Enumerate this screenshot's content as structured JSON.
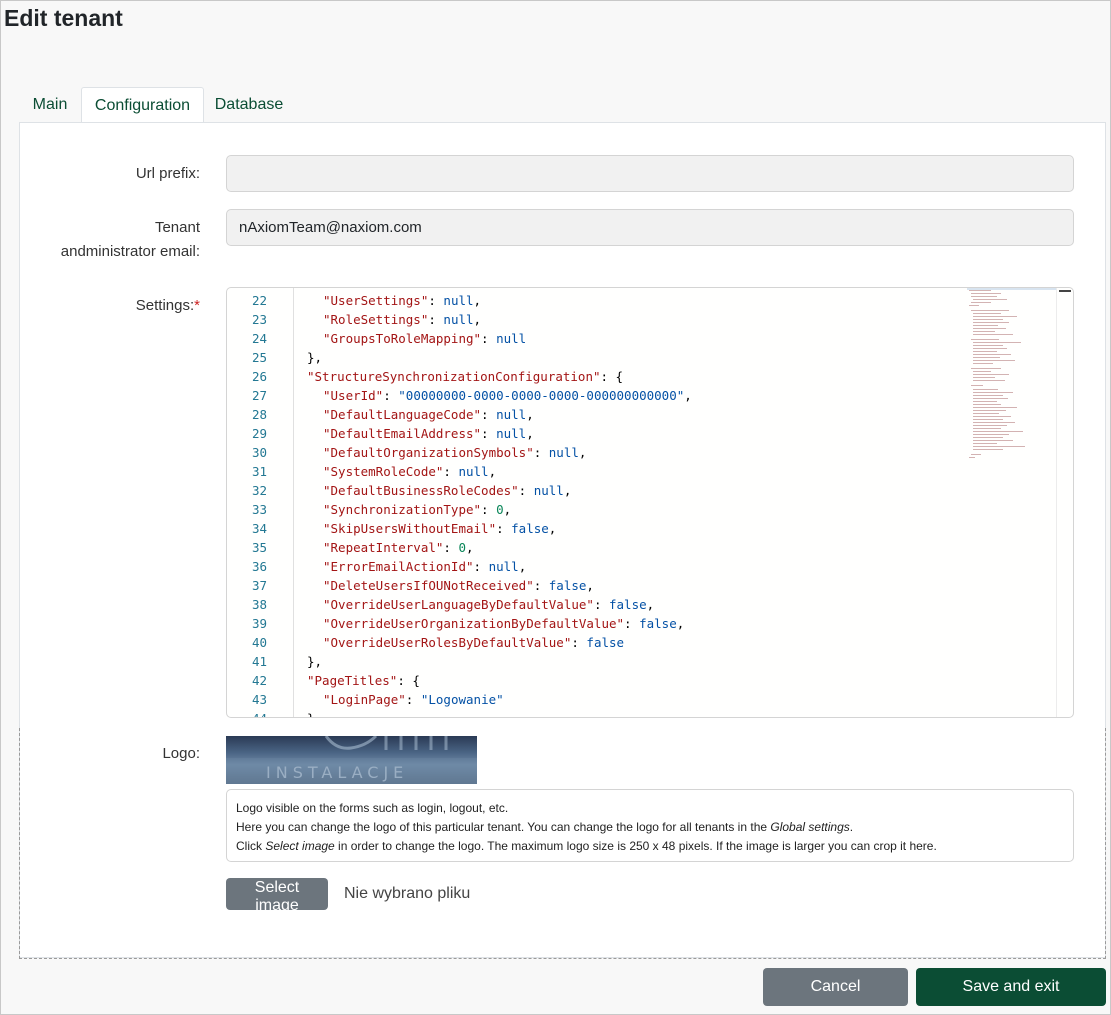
{
  "page": {
    "title": "Edit tenant"
  },
  "tabs": [
    {
      "label": "Main",
      "active": false
    },
    {
      "label": "Configuration",
      "active": true
    },
    {
      "label": "Database",
      "active": false
    }
  ],
  "form": {
    "url_prefix": {
      "label": "Url prefix:",
      "value": ""
    },
    "admin_email": {
      "label_line1": "Tenant",
      "label_line2": "andministrator email:",
      "value": "nAxiomTeam@naxiom.com"
    },
    "settings": {
      "label": "Settings:",
      "required_mark": "*",
      "lines": [
        {
          "n": "22",
          "indent": 2,
          "tokens": [
            [
              "k",
              "\"UserSettings\""
            ],
            [
              "p",
              ": "
            ],
            [
              "w",
              "null"
            ],
            [
              "p",
              ","
            ]
          ]
        },
        {
          "n": "23",
          "indent": 2,
          "tokens": [
            [
              "k",
              "\"RoleSettings\""
            ],
            [
              "p",
              ": "
            ],
            [
              "w",
              "null"
            ],
            [
              "p",
              ","
            ]
          ]
        },
        {
          "n": "24",
          "indent": 2,
          "tokens": [
            [
              "k",
              "\"GroupsToRoleMapping\""
            ],
            [
              "p",
              ": "
            ],
            [
              "w",
              "null"
            ]
          ]
        },
        {
          "n": "25",
          "indent": 1,
          "tokens": [
            [
              "p",
              "},"
            ]
          ]
        },
        {
          "n": "26",
          "indent": 1,
          "tokens": [
            [
              "k",
              "\"StructureSynchronizationConfiguration\""
            ],
            [
              "p",
              ": {"
            ]
          ]
        },
        {
          "n": "27",
          "indent": 2,
          "tokens": [
            [
              "k",
              "\"UserId\""
            ],
            [
              "p",
              ": "
            ],
            [
              "s",
              "\"00000000-0000-0000-0000-000000000000\""
            ],
            [
              "p",
              ","
            ]
          ]
        },
        {
          "n": "28",
          "indent": 2,
          "tokens": [
            [
              "k",
              "\"DefaultLanguageCode\""
            ],
            [
              "p",
              ": "
            ],
            [
              "w",
              "null"
            ],
            [
              "p",
              ","
            ]
          ]
        },
        {
          "n": "29",
          "indent": 2,
          "tokens": [
            [
              "k",
              "\"DefaultEmailAddress\""
            ],
            [
              "p",
              ": "
            ],
            [
              "w",
              "null"
            ],
            [
              "p",
              ","
            ]
          ]
        },
        {
          "n": "30",
          "indent": 2,
          "tokens": [
            [
              "k",
              "\"DefaultOrganizationSymbols\""
            ],
            [
              "p",
              ": "
            ],
            [
              "w",
              "null"
            ],
            [
              "p",
              ","
            ]
          ]
        },
        {
          "n": "31",
          "indent": 2,
          "tokens": [
            [
              "k",
              "\"SystemRoleCode\""
            ],
            [
              "p",
              ": "
            ],
            [
              "w",
              "null"
            ],
            [
              "p",
              ","
            ]
          ]
        },
        {
          "n": "32",
          "indent": 2,
          "tokens": [
            [
              "k",
              "\"DefaultBusinessRoleCodes\""
            ],
            [
              "p",
              ": "
            ],
            [
              "w",
              "null"
            ],
            [
              "p",
              ","
            ]
          ]
        },
        {
          "n": "33",
          "indent": 2,
          "tokens": [
            [
              "k",
              "\"SynchronizationType\""
            ],
            [
              "p",
              ": "
            ],
            [
              "n",
              "0"
            ],
            [
              "p",
              ","
            ]
          ]
        },
        {
          "n": "34",
          "indent": 2,
          "tokens": [
            [
              "k",
              "\"SkipUsersWithoutEmail\""
            ],
            [
              "p",
              ": "
            ],
            [
              "w",
              "false"
            ],
            [
              "p",
              ","
            ]
          ]
        },
        {
          "n": "35",
          "indent": 2,
          "tokens": [
            [
              "k",
              "\"RepeatInterval\""
            ],
            [
              "p",
              ": "
            ],
            [
              "n",
              "0"
            ],
            [
              "p",
              ","
            ]
          ]
        },
        {
          "n": "36",
          "indent": 2,
          "tokens": [
            [
              "k",
              "\"ErrorEmailActionId\""
            ],
            [
              "p",
              ": "
            ],
            [
              "w",
              "null"
            ],
            [
              "p",
              ","
            ]
          ]
        },
        {
          "n": "37",
          "indent": 2,
          "tokens": [
            [
              "k",
              "\"DeleteUsersIfOUNotReceived\""
            ],
            [
              "p",
              ": "
            ],
            [
              "w",
              "false"
            ],
            [
              "p",
              ","
            ]
          ]
        },
        {
          "n": "38",
          "indent": 2,
          "tokens": [
            [
              "k",
              "\"OverrideUserLanguageByDefaultValue\""
            ],
            [
              "p",
              ": "
            ],
            [
              "w",
              "false"
            ],
            [
              "p",
              ","
            ]
          ]
        },
        {
          "n": "39",
          "indent": 2,
          "tokens": [
            [
              "k",
              "\"OverrideUserOrganizationByDefaultValue\""
            ],
            [
              "p",
              ": "
            ],
            [
              "w",
              "false"
            ],
            [
              "p",
              ","
            ]
          ]
        },
        {
          "n": "40",
          "indent": 2,
          "tokens": [
            [
              "k",
              "\"OverrideUserRolesByDefaultValue\""
            ],
            [
              "p",
              ": "
            ],
            [
              "w",
              "false"
            ]
          ]
        },
        {
          "n": "41",
          "indent": 1,
          "tokens": [
            [
              "p",
              "},"
            ]
          ]
        },
        {
          "n": "42",
          "indent": 1,
          "tokens": [
            [
              "k",
              "\"PageTitles\""
            ],
            [
              "p",
              ": {"
            ]
          ]
        },
        {
          "n": "43",
          "indent": 2,
          "tokens": [
            [
              "k",
              "\"LoginPage\""
            ],
            [
              "p",
              ": "
            ],
            [
              "s",
              "\"Logowanie\""
            ]
          ]
        },
        {
          "n": "44",
          "indent": 1,
          "tokens": [
            [
              "p",
              "}"
            ]
          ]
        }
      ]
    },
    "logo": {
      "label": "Logo:",
      "image_text": "INSTALACJE",
      "help_line1": "Logo visible on the forms such as login, logout, etc.",
      "help_line2_pre": "Here you can change the logo of this particular tenant. You can change the logo for all tenants in the ",
      "help_line2_em": "Global settings",
      "help_line2_post": ".",
      "help_line3_pre": "Click ",
      "help_line3_em": "Select image",
      "help_line3_post": " in order to change the logo. The maximum logo size is 250 x 48 pixels. If the image is larger you can crop it here.",
      "select_button": "Select image",
      "no_file_text": "Nie wybrano pliku"
    }
  },
  "footer": {
    "cancel": "Cancel",
    "save": "Save and exit"
  }
}
